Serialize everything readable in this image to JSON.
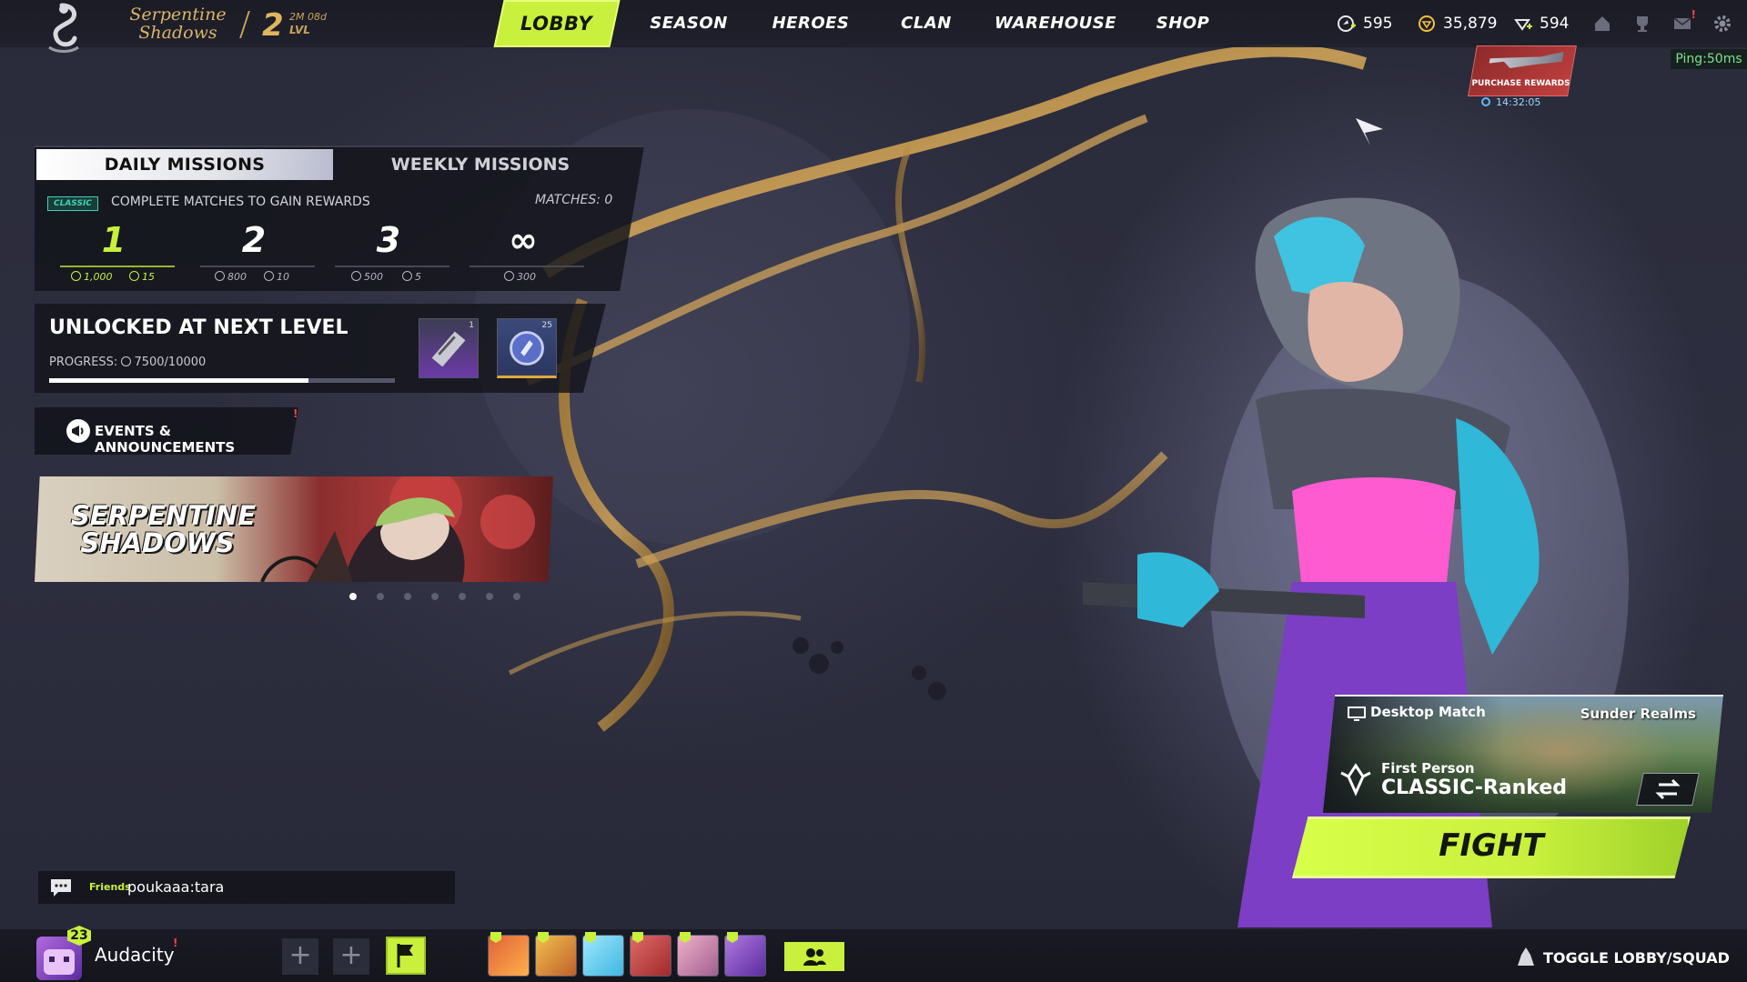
{
  "header": {
    "logo_text": "Serpentine Shadows",
    "level": "2",
    "level_time": "2M 08d",
    "level_label": "LVL",
    "nav_tabs": [
      "LOBBY",
      "SEASON",
      "HEROES",
      "CLAN",
      "WAREHOUSE",
      "SHOP"
    ],
    "active_tab": "LOBBY",
    "currencies": [
      {
        "icon": "premium-currency-icon",
        "value": "595"
      },
      {
        "icon": "coin-currency-icon",
        "value": "35,879"
      },
      {
        "icon": "gem-currency-icon",
        "value": "594"
      }
    ],
    "icons": [
      "home-icon",
      "trophy-icon",
      "mail-icon",
      "settings-icon"
    ],
    "mail_notification": "!"
  },
  "ping": "Ping:50ms",
  "promo": {
    "label": "PURCHASE REWARDS",
    "timer": "14:32:05"
  },
  "missions": {
    "tab_daily": "DAILY MISSIONS",
    "tab_weekly": "WEEKLY MISSIONS",
    "mode_badge": "CLASSIC",
    "description": "COMPLETE MATCHES TO GAIN REWARDS",
    "matches": "MATCHES: 0",
    "tiers": [
      {
        "label": "1",
        "reward_a": "1,000",
        "reward_b": "15"
      },
      {
        "label": "2",
        "reward_a": "800",
        "reward_b": "10"
      },
      {
        "label": "3",
        "reward_a": "500",
        "reward_b": "5"
      },
      {
        "label": "∞",
        "reward_a": "300",
        "reward_b": ""
      }
    ]
  },
  "unlock": {
    "title": "UNLOCKED AT NEXT LEVEL",
    "progress_label": "PROGRESS:",
    "progress_value": "7500/10000",
    "progress_fraction": 0.75,
    "rewards": [
      {
        "icon": "weapon-skin-icon",
        "count": "1"
      },
      {
        "icon": "token-icon",
        "count": "25"
      }
    ]
  },
  "events": {
    "title": "EVENTS & ANNOUNCEMENTS",
    "notification": "!",
    "banner_title": "SERPENTINE SHADOWS",
    "pages": 7,
    "active_page": 0
  },
  "chat": {
    "channel": "Friends",
    "message": "poukaaa:tara"
  },
  "player": {
    "name": "Audacity",
    "level": "23",
    "notification": "!"
  },
  "bottom": {
    "toggle_label": "TOGGLE LOBBY/SQUAD"
  },
  "match": {
    "mode": "Desktop Match",
    "map": "Sunder Realms",
    "perspective": "First Person",
    "queue": "CLASSIC-Ranked",
    "fight_label": "FIGHT"
  },
  "colors": {
    "accent": "#c8f03c",
    "gold": "#d9b56a",
    "panel": "#12131a",
    "alert": "#ff4040"
  }
}
